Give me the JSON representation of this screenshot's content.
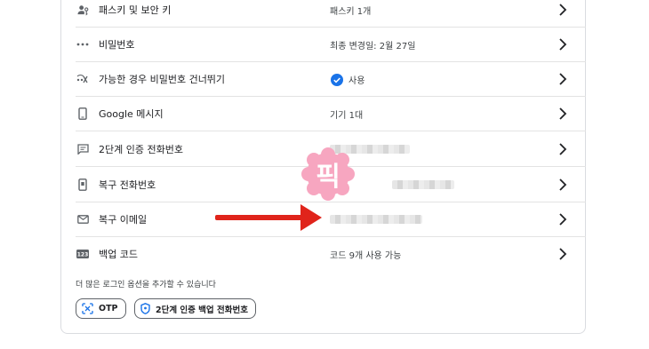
{
  "rows": [
    {
      "label": "패스키 및 보안 키",
      "value": "패스키 1개",
      "icon": "passkey-icon"
    },
    {
      "label": "비밀번호",
      "value": "최종 변경일: 2월 27일",
      "icon": "password-dots-icon"
    },
    {
      "label": "가능한 경우 비밀번호 건너뛰기",
      "value": "사용",
      "icon": "skip-password-icon"
    },
    {
      "label": "Google 메시지",
      "value": "기기 1대",
      "icon": "phone-icon"
    },
    {
      "label": "2단계 인증 전화번호",
      "value": "",
      "icon": "message-icon"
    },
    {
      "label": "복구 전화번호",
      "value": "",
      "icon": "recovery-phone-icon"
    },
    {
      "label": "복구 이메일",
      "value": "",
      "icon": "mail-icon"
    },
    {
      "label": "백업 코드",
      "value": "코드 9개 사용 가능",
      "icon": "backup-code-icon"
    }
  ],
  "more_options_hint": "더 많은 로그인 옵션을 추가할 수 있습니다",
  "chips": [
    {
      "label": "OTP",
      "icon": "otp-icon"
    },
    {
      "label": "2단계 인증 백업 전화번호",
      "icon": "shield-icon"
    }
  ],
  "watermark": {
    "text": "픽",
    "color": "#f48fb1"
  },
  "annotation_arrow_color": "#e0241b",
  "accent_color": "#1a73e8"
}
